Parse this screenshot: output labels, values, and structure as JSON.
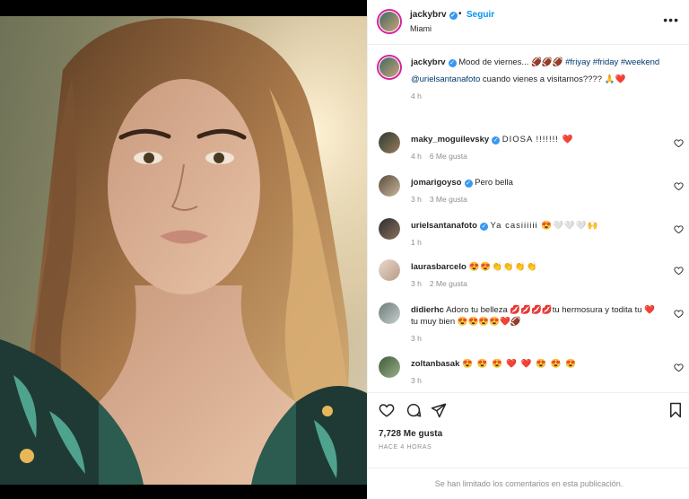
{
  "post": {
    "username": "jackybrv",
    "follow_label": "Seguir",
    "separator": "•",
    "location": "Miami",
    "more_label": "•••"
  },
  "caption": {
    "username": "jackybrv",
    "text": "Mood de viernes... 🏈🏈🏈",
    "hashtags": "#friyay #friday #weekend",
    "mention": "@urielsantanafoto",
    "mention_text": " cuando vienes a visitarnos???? 🙏❤️",
    "time": "4 h"
  },
  "comments": [
    {
      "username": "maky_moguilevsky",
      "verified": true,
      "text": "DIOSA !!!!!!! ❤️",
      "time": "4 h",
      "likes": "6 Me gusta"
    },
    {
      "username": "jomarigoyso",
      "verified": true,
      "text": "Pero bella",
      "time": "3 h",
      "likes": "3 Me gusta"
    },
    {
      "username": "urielsantanafoto",
      "verified": true,
      "text": "Ya casiiiiii 😍🤍🤍🤍🙌",
      "time": "1 h",
      "likes": ""
    },
    {
      "username": "laurasbarcelo",
      "verified": false,
      "text": "😍😍👏👏👏👏",
      "time": "3 h",
      "likes": "2 Me gusta"
    },
    {
      "username": "didierhc",
      "verified": false,
      "text": "Adoro tu belleza 💋💋💋💋tu hermosura y todita tu ❤️tu muy bien 😍😍😍😍❤️🏈",
      "time": "3 h",
      "likes": ""
    },
    {
      "username": "zoltanbasak",
      "verified": false,
      "text": "😍 😍 😍 ❤️ ❤️ 😍 😍 😍",
      "time": "3 h",
      "likes": ""
    }
  ],
  "footer": {
    "likes": "7,728 Me gusta",
    "ago": "HACE 4 HORAS",
    "limited_notice": "Se han limitado los comentarios en esta publicación."
  },
  "colors": {
    "accent": "#0095f6",
    "verified": "#3897f0",
    "muted": "#8e8e8e",
    "border": "#efefef"
  },
  "icons": {
    "like": "heart-icon",
    "comment": "comment-icon",
    "share": "send-icon",
    "save": "bookmark-icon",
    "comment_like": "heart-icon",
    "more": "more-options-icon"
  }
}
